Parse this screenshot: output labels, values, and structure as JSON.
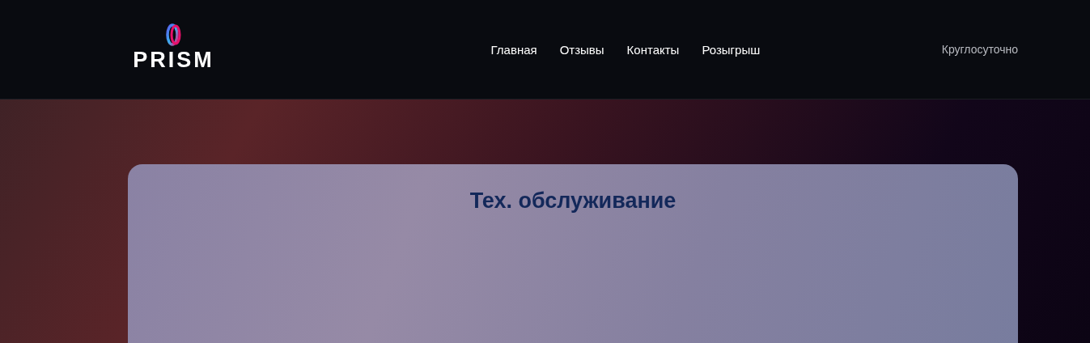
{
  "header": {
    "logo": "PRISM",
    "nav": [
      {
        "label": "Главная"
      },
      {
        "label": "Отзывы"
      },
      {
        "label": "Контакты"
      },
      {
        "label": "Розыгрыш"
      }
    ],
    "hours": "Круглосуточно"
  },
  "card": {
    "title": "Тех. обслуживание"
  }
}
